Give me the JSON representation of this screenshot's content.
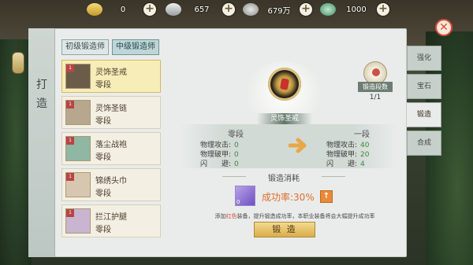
{
  "resources": [
    {
      "icon": "gold-ingot-icon",
      "value": "0"
    },
    {
      "icon": "silver-ingot-icon",
      "value": "657"
    },
    {
      "icon": "copper-coin-icon",
      "value": "679万"
    },
    {
      "icon": "jade-coin-icon",
      "value": "1000"
    }
  ],
  "side_title": "打造",
  "tier_tabs": [
    "初级锻造师",
    "中级锻造师"
  ],
  "items": [
    {
      "name": "灵饰圣戒",
      "level": "零段",
      "selected": true
    },
    {
      "name": "灵饰圣链",
      "level": "零段",
      "selected": false
    },
    {
      "name": "落尘战袍",
      "level": "零段",
      "selected": false
    },
    {
      "name": "锦绣头巾",
      "level": "零段",
      "selected": false
    },
    {
      "name": "拦江护腿",
      "level": "零段",
      "selected": false
    }
  ],
  "item_badge": "1",
  "selected_item": {
    "name": "灵饰圣戒"
  },
  "forge_level": {
    "label": "锻造段数",
    "count": "1/1"
  },
  "compare": {
    "left": {
      "title": "零段",
      "rows": [
        {
          "label": "物理攻击:",
          "value": "0"
        },
        {
          "label": "物理破甲:",
          "value": "0"
        },
        {
          "label": "闪　　避:",
          "value": "0"
        }
      ]
    },
    "right": {
      "title": "一段",
      "rows": [
        {
          "label": "物理攻击:",
          "value": "40"
        },
        {
          "label": "物理破甲:",
          "value": "20"
        },
        {
          "label": "闪　　避:",
          "value": "4"
        }
      ]
    }
  },
  "cost": {
    "title": "锻造消耗",
    "material_count": "0",
    "success_rate": "成功率:30%",
    "up_label": "↑"
  },
  "hint": {
    "prefix": "添加",
    "red": "红色",
    "suffix": "装备，提升锻造成功率，本职业装备将会大幅提升成功率"
  },
  "forge_button": "锻 造",
  "right_tabs": [
    {
      "label": "强化",
      "active": false
    },
    {
      "label": "宝石",
      "active": false
    },
    {
      "label": "锻造",
      "active": true
    },
    {
      "label": "合成",
      "active": false
    }
  ],
  "close_label": "✕",
  "colors": {
    "accent_green": "#3d8a3d",
    "rate_orange": "#e06d2a",
    "selected_item": "#f7edb8"
  }
}
